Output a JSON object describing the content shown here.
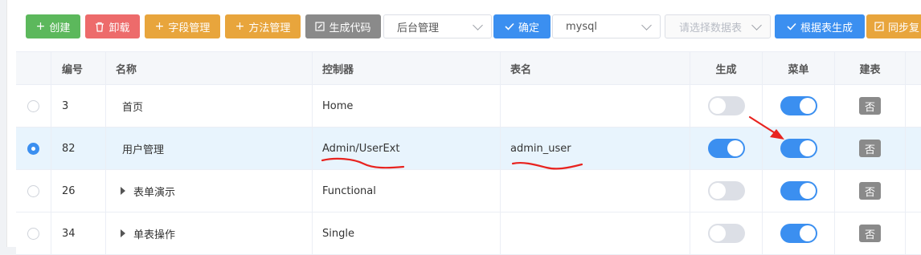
{
  "toolbar": {
    "create": "创建",
    "uninstall": "卸载",
    "field_manage": "字段管理",
    "method_manage": "方法管理",
    "generate_code": "生成代码",
    "module_select": "后台管理",
    "confirm": "确定",
    "db_select": "mysql",
    "table_placeholder": "请选择数据表",
    "gen_by_table": "根据表生成",
    "sync": "同步复"
  },
  "table": {
    "headers": {
      "id": "编号",
      "name": "名称",
      "controller": "控制器",
      "table_name": "表名",
      "generate": "生成",
      "menu": "菜单",
      "create_table": "建表"
    },
    "rows": [
      {
        "selected": false,
        "id": "3",
        "name": "首页",
        "expandable": false,
        "controller": "Home",
        "table_name": "",
        "generate": false,
        "menu": true,
        "create_table": "否"
      },
      {
        "selected": true,
        "id": "82",
        "name": "用户管理",
        "expandable": false,
        "controller": "Admin/UserExt",
        "table_name": "admin_user",
        "generate": true,
        "menu": true,
        "create_table": "否"
      },
      {
        "selected": false,
        "id": "26",
        "name": "表单演示",
        "expandable": true,
        "controller": "Functional",
        "table_name": "",
        "generate": false,
        "menu": true,
        "create_table": "否"
      },
      {
        "selected": false,
        "id": "34",
        "name": "单表操作",
        "expandable": true,
        "controller": "Single",
        "table_name": "",
        "generate": false,
        "menu": true,
        "create_table": "否"
      }
    ]
  },
  "colors": {
    "primary": "#3b8ff0",
    "success": "#5cb85c",
    "danger": "#ed6b6b",
    "warning": "#e8a53c",
    "info": "#8a8a8a",
    "annotation": "#e8231f"
  },
  "icons": {
    "create": "plus-icon",
    "uninstall": "trash-icon",
    "field_manage": "plus-icon",
    "method_manage": "plus-icon",
    "generate_code": "edit-icon",
    "confirm": "check-icon",
    "gen_by_table": "check-icon",
    "sync": "edit-icon"
  }
}
